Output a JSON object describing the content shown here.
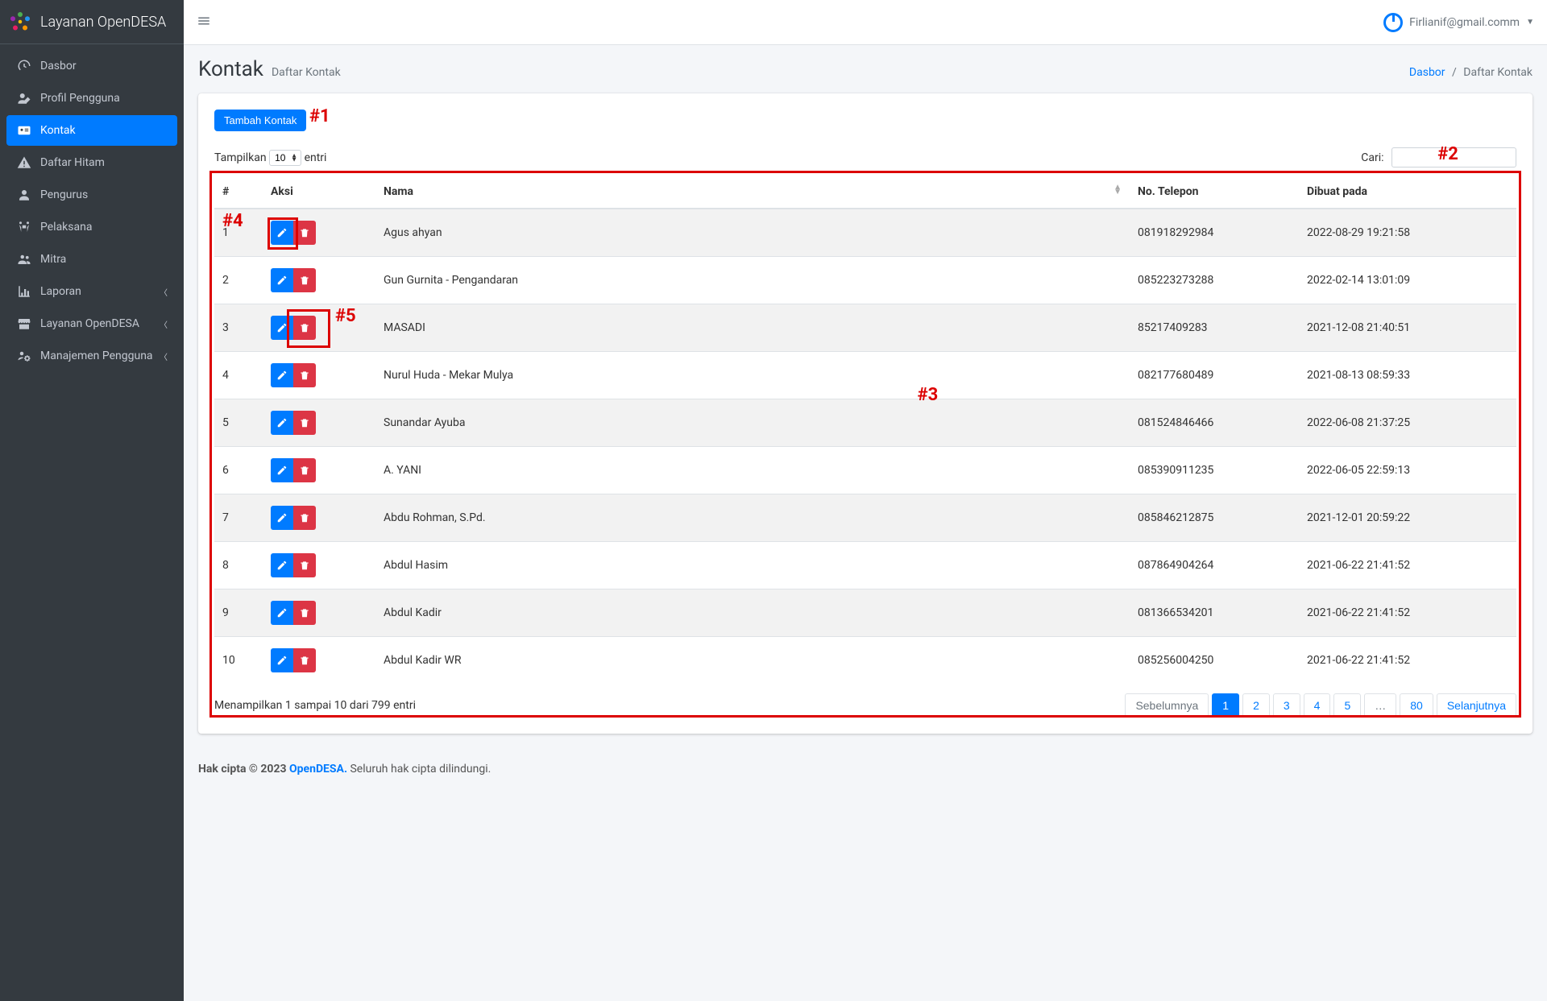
{
  "brand": "Layanan OpenDESA",
  "user_email": "Firlianif@gmail.comm",
  "sidebar": {
    "items": [
      {
        "label": "Dasbor",
        "icon": "dashboard",
        "chevron": false
      },
      {
        "label": "Profil Pengguna",
        "icon": "user-edit",
        "chevron": false
      },
      {
        "label": "Kontak",
        "icon": "address-card",
        "chevron": false,
        "active": true
      },
      {
        "label": "Daftar Hitam",
        "icon": "warning",
        "chevron": false
      },
      {
        "label": "Pengurus",
        "icon": "user",
        "chevron": false
      },
      {
        "label": "Pelaksana",
        "icon": "people-carry",
        "chevron": false
      },
      {
        "label": "Mitra",
        "icon": "users",
        "chevron": false
      },
      {
        "label": "Laporan",
        "icon": "chart",
        "chevron": true
      },
      {
        "label": "Layanan OpenDESA",
        "icon": "store",
        "chevron": true
      },
      {
        "label": "Manajemen Pengguna",
        "icon": "users-cog",
        "chevron": true
      }
    ]
  },
  "header": {
    "title": "Kontak",
    "subtitle": "Daftar Kontak",
    "breadcrumb_root": "Dasbor",
    "breadcrumb_current": "Daftar Kontak"
  },
  "card": {
    "add_button": "Tambah Kontak",
    "length_prefix": "Tampilkan",
    "length_value": "10",
    "length_suffix": "entri",
    "search_label": "Cari:",
    "columns": [
      "#",
      "Aksi",
      "Nama",
      "No. Telepon",
      "Dibuat pada"
    ],
    "rows": [
      {
        "n": "1",
        "nama": "Agus ahyan",
        "tel": "081918292984",
        "date": "2022-08-29 19:21:58"
      },
      {
        "n": "2",
        "nama": "Gun Gurnita - Pengandaran",
        "tel": "085223273288",
        "date": "2022-02-14 13:01:09"
      },
      {
        "n": "3",
        "nama": "MASADI",
        "tel": "85217409283",
        "date": "2021-12-08 21:40:51"
      },
      {
        "n": "4",
        "nama": "Nurul Huda - Mekar Mulya",
        "tel": "082177680489",
        "date": "2021-08-13 08:59:33"
      },
      {
        "n": "5",
        "nama": "Sunandar Ayuba",
        "tel": "081524846466",
        "date": "2022-06-08 21:37:25"
      },
      {
        "n": "6",
        "nama": "A. YANI",
        "tel": "085390911235",
        "date": "2022-06-05 22:59:13"
      },
      {
        "n": "7",
        "nama": "Abdu Rohman, S.Pd.",
        "tel": "085846212875",
        "date": "2021-12-01 20:59:22"
      },
      {
        "n": "8",
        "nama": "Abdul Hasim",
        "tel": "087864904264",
        "date": "2021-06-22 21:41:52"
      },
      {
        "n": "9",
        "nama": "Abdul Kadir",
        "tel": "081366534201",
        "date": "2021-06-22 21:41:52"
      },
      {
        "n": "10",
        "nama": "Abdul Kadir WR",
        "tel": "085256004250",
        "date": "2021-06-22 21:41:52"
      }
    ],
    "info": "Menampilkan 1 sampai 10 dari 799 entri",
    "pagination": {
      "prev": "Sebelumnya",
      "pages": [
        "1",
        "2",
        "3",
        "4",
        "5",
        "…",
        "80"
      ],
      "active": "1",
      "next": "Selanjutnya"
    }
  },
  "annotations": {
    "a1": "#1",
    "a2": "#2",
    "a3": "#3",
    "a4": "#4",
    "a5": "#5"
  },
  "footer": {
    "prefix": "Hak cipta © 2023 ",
    "link": "OpenDESA.",
    "suffix": " Seluruh hak cipta dilindungi."
  }
}
